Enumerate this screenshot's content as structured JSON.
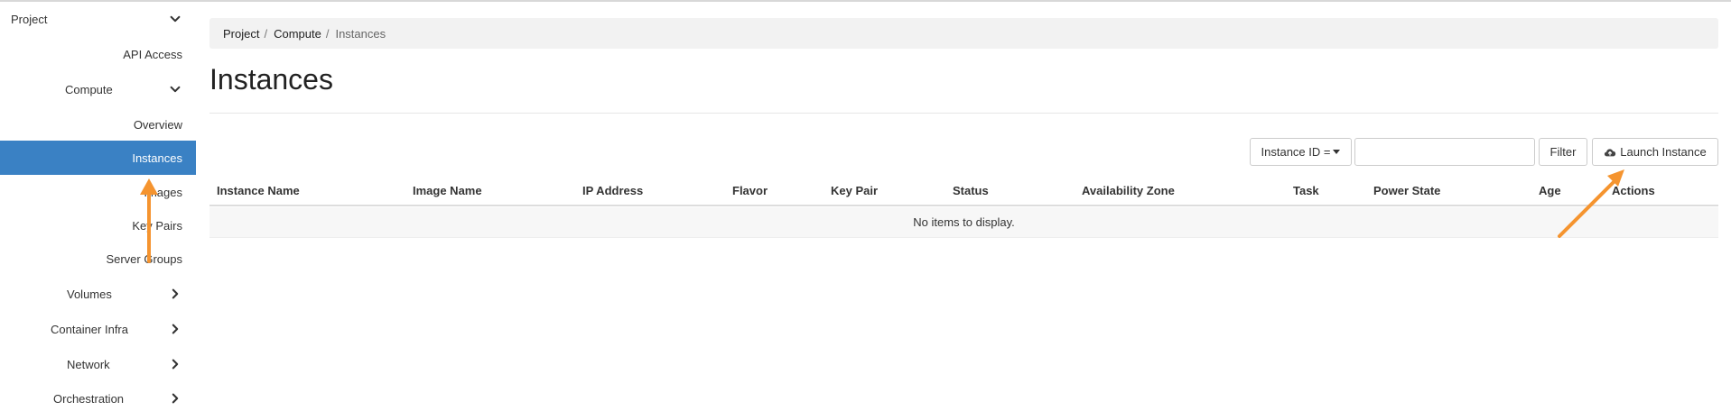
{
  "sidebar": {
    "project": "Project",
    "api_access": "API Access",
    "compute": "Compute",
    "overview": "Overview",
    "instances": "Instances",
    "images": "Images",
    "key_pairs": "Key Pairs",
    "server_groups": "Server Groups",
    "volumes": "Volumes",
    "container_infra": "Container Infra",
    "network": "Network",
    "orchestration": "Orchestration",
    "active_color": "#3a81c4"
  },
  "breadcrumb": {
    "items": [
      "Project",
      "Compute",
      "Instances"
    ],
    "separator": "/"
  },
  "page": {
    "title": "Instances"
  },
  "filter": {
    "field_label": "Instance ID =",
    "input_value": "",
    "filter_label": "Filter",
    "launch_label": "Launch Instance"
  },
  "table": {
    "columns": [
      "Instance Name",
      "Image Name",
      "IP Address",
      "Flavor",
      "Key Pair",
      "Status",
      "Availability Zone",
      "Task",
      "Power State",
      "Age",
      "Actions"
    ],
    "empty_message": "No items to display."
  },
  "annotation_color": "#f5942f"
}
